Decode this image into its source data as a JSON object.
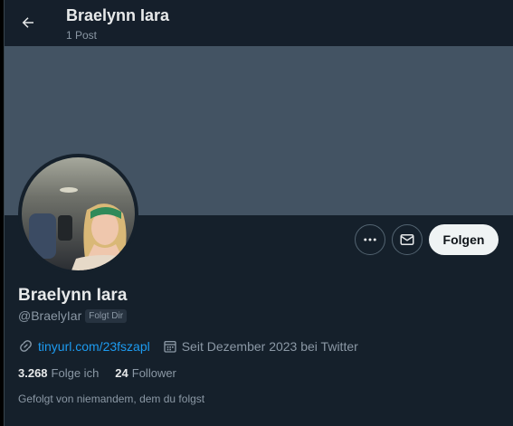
{
  "header": {
    "title": "Braelynn Iara",
    "post_count": "1 Post"
  },
  "profile": {
    "display_name": "Braelynn Iara",
    "handle": "@BraelyIar",
    "follows_you_badge": "Folgt Dir",
    "website": "tinyurl.com/23fszapl",
    "joined": "Seit Dezember 2023 bei Twitter",
    "following_count": "3.268",
    "following_label": "Folge ich",
    "followers_count": "24",
    "followers_label": "Follower",
    "followed_by": "Gefolgt von niemandem, dem du folgst"
  },
  "actions": {
    "follow_label": "Folgen",
    "more_icon": "more-icon",
    "message_icon": "mail-icon"
  },
  "colors": {
    "background": "#15202b",
    "banner": "#435363",
    "accent_link": "#1d9bf0",
    "secondary_text": "#8b98a5",
    "follow_button_bg": "#eff3f4"
  }
}
